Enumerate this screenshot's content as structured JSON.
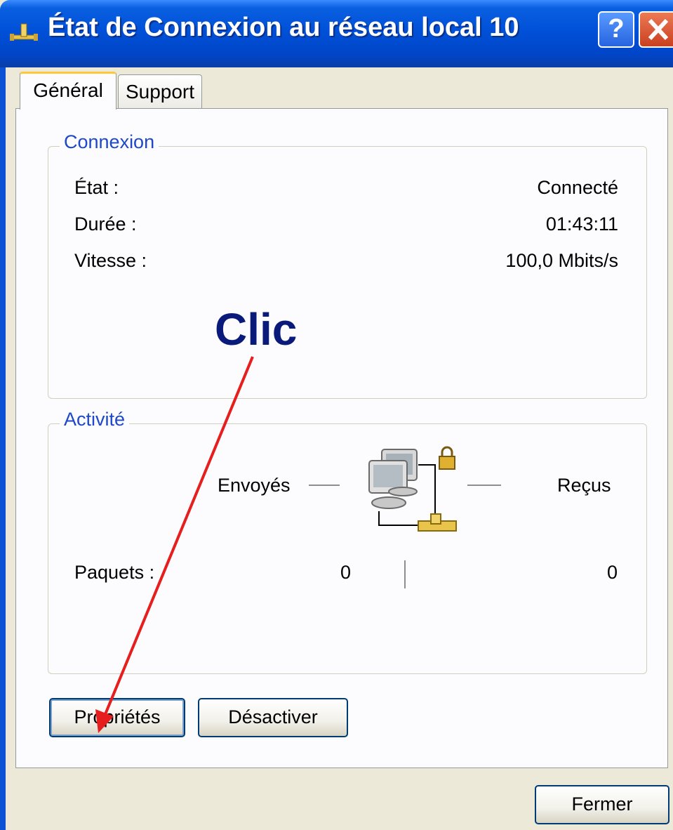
{
  "window": {
    "title": "État de Connexion au réseau local 10",
    "help_label": "?",
    "close_label": "X"
  },
  "tabs": [
    {
      "label": "Général",
      "active": true
    },
    {
      "label": "Support",
      "active": false
    }
  ],
  "connexion": {
    "legend": "Connexion",
    "rows": [
      {
        "label": "État :",
        "value": "Connecté"
      },
      {
        "label": "Durée :",
        "value": "01:43:11"
      },
      {
        "label": "Vitesse :",
        "value": "100,0 Mbits/s"
      }
    ]
  },
  "activite": {
    "legend": "Activité",
    "sent_label": "Envoyés",
    "received_label": "Reçus",
    "packets_label": "Paquets :",
    "packets_sent": "0",
    "packets_received": "0",
    "network_icon": "network-computers-lock-icon"
  },
  "buttons": {
    "properties": "Propriétés",
    "disable": "Désactiver",
    "close": "Fermer"
  },
  "annotation": {
    "text": "Clic",
    "color": "#0a1a7a",
    "arrow_color": "#e61e1e"
  },
  "colors": {
    "titlebar": "#0051d8",
    "legend": "#1e48c8",
    "dialog_bg": "#ece9d8"
  }
}
